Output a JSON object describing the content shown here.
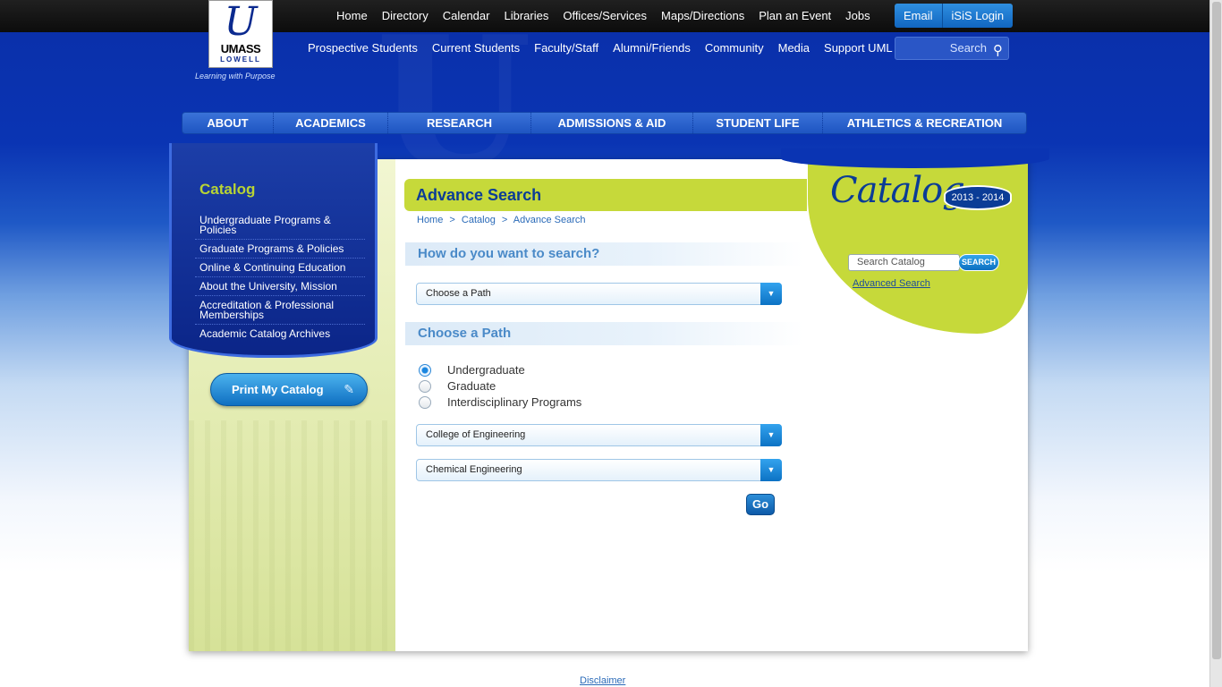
{
  "logo": {
    "mark": "U",
    "name_line1": "UMASS",
    "name_line2": "LOWELL",
    "tagline": "Learning with Purpose"
  },
  "topnav": [
    "Home",
    "Directory",
    "Calendar",
    "Libraries",
    "Offices/Services",
    "Maps/Directions",
    "Plan an Event",
    "Jobs"
  ],
  "topbuttons": {
    "email": "Email",
    "isis": "iSiS Login"
  },
  "secnav": [
    "Prospective Students",
    "Current Students",
    "Faculty/Staff",
    "Alumni/Friends",
    "Community",
    "Media",
    "Support UML"
  ],
  "site_search": {
    "placeholder": "Search"
  },
  "mainnav": [
    "ABOUT",
    "ACADEMICS",
    "RESEARCH",
    "ADMISSIONS & AID",
    "STUDENT LIFE",
    "ATHLETICS & RECREATION"
  ],
  "sidebar": {
    "title": "Catalog",
    "items": [
      "Undergraduate Programs & Policies",
      "Graduate Programs & Policies",
      "Online & Continuing Education",
      "About the University, Mission",
      "Accreditation & Professional Memberships",
      "Academic Catalog Archives"
    ],
    "print_button": "Print My Catalog"
  },
  "main": {
    "title": "Advance Search",
    "breadcrumb": [
      "Home",
      ">",
      "Catalog",
      ">",
      "Advance Search"
    ],
    "question": "How do you want to search?",
    "search_mode_select": "Choose a Path",
    "path_heading": "Choose a Path",
    "radios": [
      {
        "label": "Undergraduate",
        "checked": true
      },
      {
        "label": "Graduate",
        "checked": false
      },
      {
        "label": "Interdisciplinary Programs",
        "checked": false
      }
    ],
    "college_select": "College of Engineering",
    "program_select": "Chemical Engineering",
    "go_button": "Go"
  },
  "catalog_panel": {
    "title": "Catalog",
    "years": "2013 - 2014",
    "search_placeholder": "Search Catalog",
    "search_button": "SEARCH",
    "advanced_link": "Advanced Search"
  },
  "footer": {
    "disclaimer": "Disclaimer"
  },
  "colors": {
    "brand_blue": "#0a34b3",
    "accent_green": "#c6d93a",
    "button_blue": "#1166c0"
  },
  "icons": {
    "site_search": "search-icon",
    "print": "pencil-icon",
    "select_arrow": "chevron-down-icon"
  }
}
